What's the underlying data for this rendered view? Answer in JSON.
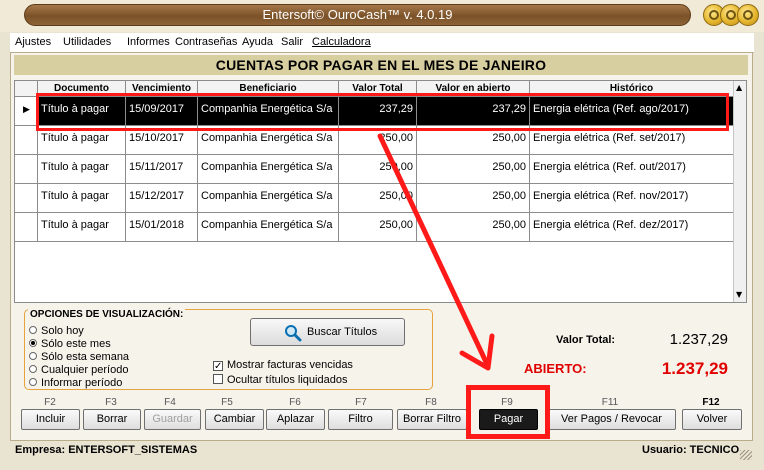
{
  "window": {
    "title": "Entersoft© OuroCash™ v. 4.0.19"
  },
  "menu": [
    "Ajustes",
    "Utilidades",
    "Informes",
    "Contraseñas",
    "Ayuda",
    "Salir",
    "Calculadora"
  ],
  "heading": "CUENTAS POR PAGAR EN EL MES DE JANEIRO",
  "table": {
    "columns": [
      "Documento",
      "Vencimiento",
      "Beneficiario",
      "Valor Total",
      "Valor en abierto",
      "Histórico"
    ],
    "rows": [
      [
        "Título à pagar",
        "15/09/2017",
        "Companhia Energética S/a",
        "237,29",
        "237,29",
        "Energia elétrica (Ref. ago/2017)"
      ],
      [
        "Título à pagar",
        "15/10/2017",
        "Companhia Energética S/a",
        "250,00",
        "250,00",
        "Energia elétrica (Ref. set/2017)"
      ],
      [
        "Título à pagar",
        "15/11/2017",
        "Companhia Energética S/a",
        "250,00",
        "250,00",
        "Energia elétrica (Ref. out/2017)"
      ],
      [
        "Título à pagar",
        "15/12/2017",
        "Companhia Energética S/a",
        "250,00",
        "250,00",
        "Energia elétrica (Ref. nov/2017)"
      ],
      [
        "Título à pagar",
        "15/01/2018",
        "Companhia Energética S/a",
        "250,00",
        "250,00",
        "Energia elétrica (Ref. dez/2017)"
      ]
    ]
  },
  "options": {
    "legend": "OPCIONES DE VISUALIZACIÓN:",
    "radios": [
      "Solo hoy",
      "Sólo este mes",
      "Sólo esta semana",
      "Cualquier período",
      "Informar período"
    ],
    "selected_radio": "Sólo este mes",
    "checks": [
      {
        "label": "Mostrar facturas vencidas",
        "checked": true
      },
      {
        "label": "Ocultar títulos liquidados",
        "checked": false
      }
    ],
    "search_button": "Buscar Títulos"
  },
  "totals": {
    "total_label": "Valor Total:",
    "total_value": "1.237,29",
    "open_label": "ABIERTO:",
    "open_value": "1.237,29"
  },
  "toolbar": {
    "fkeys": [
      "F2",
      "F3",
      "F4",
      "F5",
      "F6",
      "F7",
      "F8",
      "F9",
      "F11",
      "F12"
    ],
    "buttons": [
      "Incluir",
      "Borrar",
      "Guardar",
      "Cambiar",
      "Aplazar",
      "Filtro",
      "Borrar Filtro",
      "Pagar",
      "Ver Pagos / Revocar",
      "Volver"
    ]
  },
  "status": {
    "company": "Empresa: ENTERSOFT_SISTEMAS",
    "user": "Usuario: TECNICO"
  },
  "colors": {
    "selection_bg": "#000000",
    "annotation_red": "#ff1a1a",
    "open_value": "#e00000",
    "title_bar": "#7b5228"
  }
}
